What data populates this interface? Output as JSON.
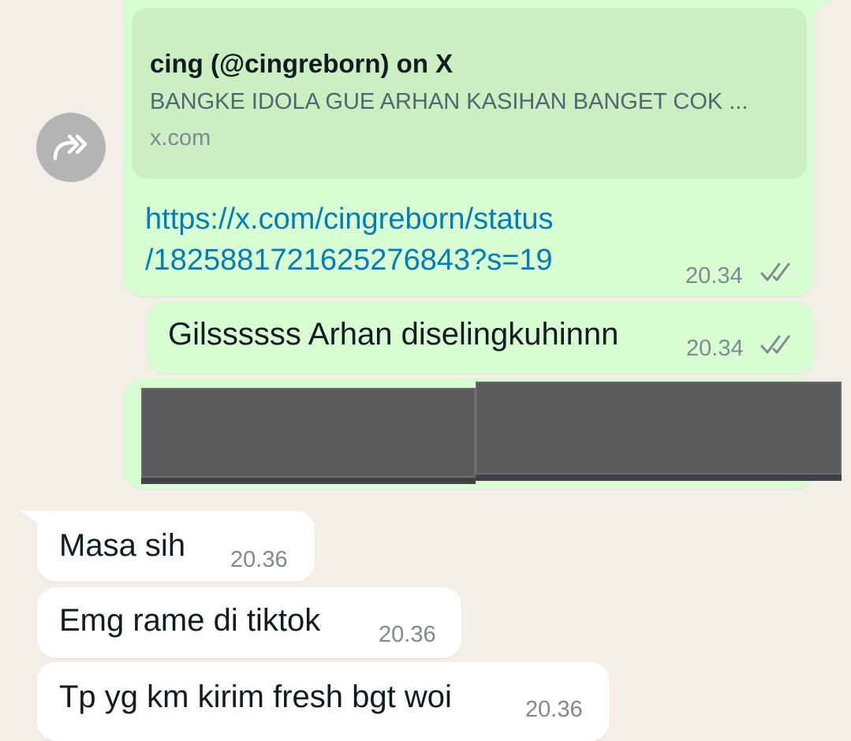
{
  "messages": [
    {
      "direction": "outgoing",
      "forwarded": true,
      "preview": {
        "title": "cing (@cingreborn) on X",
        "description": "BANGKE IDOLA GUE ARHAN KASIHAN BANGET COK ...",
        "domain": "x.com"
      },
      "link_line1": "https://x.com/cingreborn/status",
      "link_line2": "/1825881721625276843?s=19",
      "time": "20.34",
      "status": "read"
    },
    {
      "direction": "outgoing",
      "text": "Gilssssss Arhan diselingkuhinnn",
      "time": "20.34",
      "status": "read"
    },
    {
      "direction": "outgoing",
      "type": "image",
      "note": "censored image"
    },
    {
      "direction": "incoming",
      "text": "Masa sih",
      "time": "20.36"
    },
    {
      "direction": "incoming",
      "text": "Emg rame di tiktok",
      "time": "20.36"
    },
    {
      "direction": "incoming",
      "text": "Tp yg km kirim fresh bgt woi",
      "time": "20.36"
    }
  ],
  "icons": {
    "forward": "forward-icon",
    "read_receipt": "double-check-icon"
  },
  "colors": {
    "background": "#f3efe8",
    "outgoing_bubble": "#d9fdd3",
    "incoming_bubble": "#ffffff",
    "link": "#027eb5",
    "read_ticks": "#7f8a8f"
  }
}
